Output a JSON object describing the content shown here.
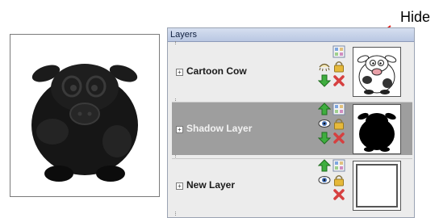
{
  "annotation": {
    "label": "Hide"
  },
  "panel": {
    "title": "Layers"
  },
  "layers": [
    {
      "name": "Cartoon Cow",
      "selected": false,
      "visibility_icon": "eye-closed-icon",
      "thumbnail": "cow"
    },
    {
      "name": "Shadow Layer",
      "selected": true,
      "visibility_icon": "eye-icon",
      "thumbnail": "shadow"
    },
    {
      "name": "New Layer",
      "selected": false,
      "visibility_icon": "eye-icon",
      "thumbnail": "empty"
    }
  ],
  "colors": {
    "panel_bg": "#ececec",
    "selected_bg": "#9e9e9e",
    "arrow": "#e0201c",
    "up_arrow": "#2f9a2f",
    "delete": "#d64040"
  }
}
